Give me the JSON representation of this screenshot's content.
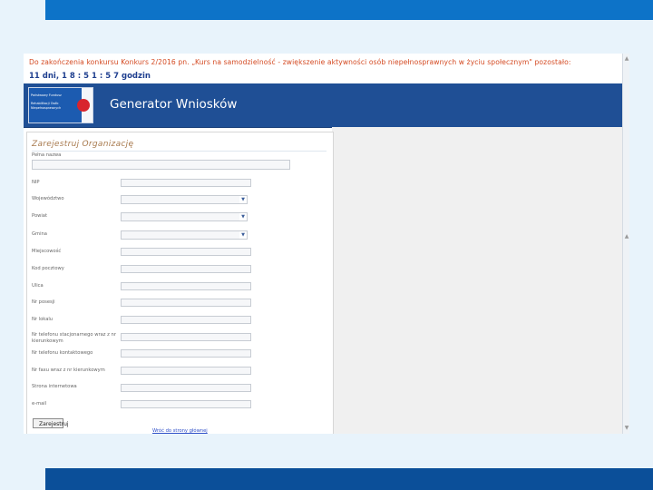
{
  "countdown": {
    "notice": "Do zakończenia konkursu Konkurs 2/2016 pn. „Kurs na samodzielność - zwiększenie aktywności osób niepełnosprawnych w życiu społecznym\" pozostało:",
    "timer": "11 dni, 1 8 : 5 1 : 5 7 godzin"
  },
  "header": {
    "logo_lines": [
      "Państwowy Fundusz",
      "Rehabilitacji Osób",
      "Niepełnosprawnych"
    ],
    "title": "Generator Wniosków"
  },
  "form": {
    "title": "Zarejestruj Organizację",
    "fields": {
      "full_name": "Pełna nazwa",
      "nip": "NIP",
      "voivodeship": "Województwo",
      "county": "Powiat",
      "commune": "Gmina",
      "city": "Miejscowość",
      "postal_code": "Kod pocztowy",
      "street": "Ulica",
      "house_no": "Nr posesji",
      "local_no": "Nr lokalu",
      "phone_prefix": "Nr telefonu stacjonarnego wraz z nr kierunkowym",
      "phone_contact": "Nr telefonu kontaktowego",
      "fax": "Nr faxu wraz z nr kierunkowym",
      "website": "Strona internetowa",
      "email": "e-mail"
    },
    "submit_label": "Zarejestruj",
    "back_link": "Wróć do strony głównej"
  },
  "colors": {
    "accent": "#0d73c8",
    "header_bg": "#1f4f95",
    "notice_text": "#d44a22"
  },
  "icons": {
    "select_arrow": "chevron-down-icon",
    "scroll_up": "arrow-up-icon",
    "scroll_down": "arrow-down-icon"
  }
}
